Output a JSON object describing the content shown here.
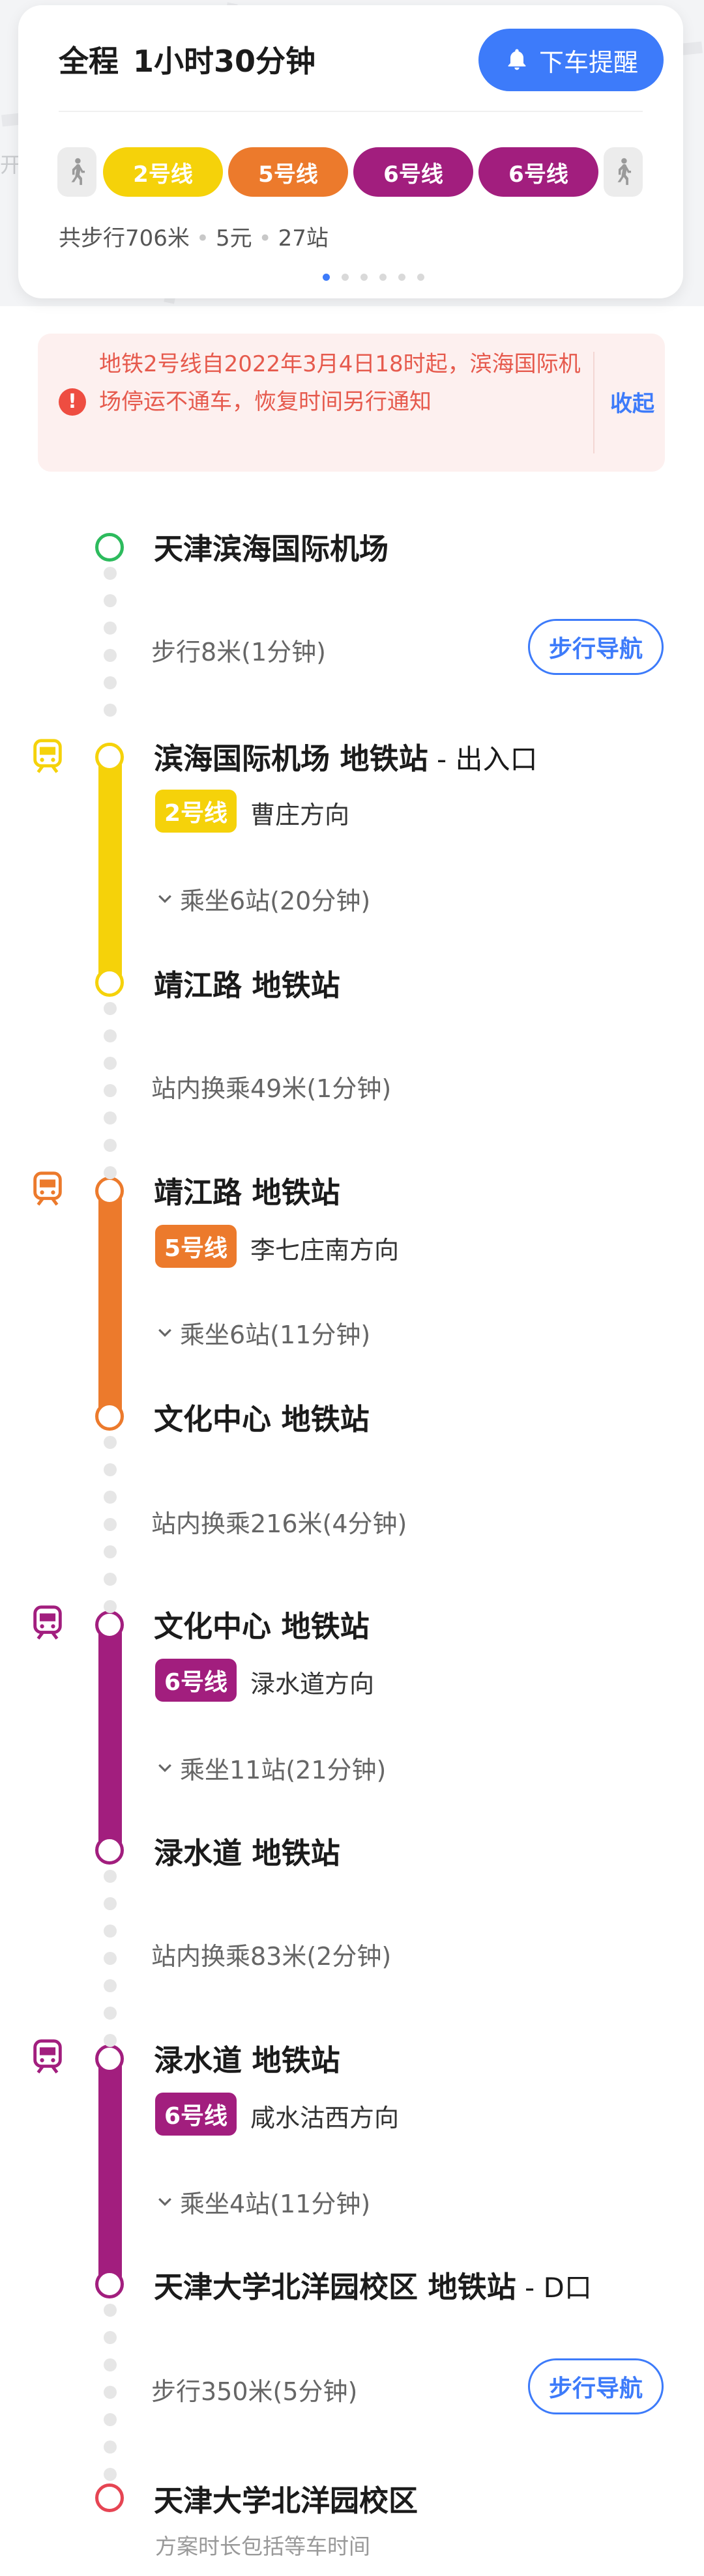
{
  "map": {
    "label": "开"
  },
  "summary": {
    "total_label": "全程",
    "duration": "1小时30分钟",
    "remind_button": "下车提醒",
    "lines": [
      {
        "label": "2号线",
        "color": "#f5d20a",
        "text_color": "#ffffff"
      },
      {
        "label": "5号线",
        "color": "#ec7a2c",
        "text_color": "#ffffff"
      },
      {
        "label": "6号线",
        "color": "#a21e7e",
        "text_color": "#ffffff"
      },
      {
        "label": "6号线",
        "color": "#a21e7e",
        "text_color": "#ffffff"
      }
    ],
    "walk_total": "共步行706米",
    "fare": "5元",
    "stops": "27站",
    "page_count": 6,
    "active_page": 1
  },
  "notice": {
    "text": "地铁2号线自2022年3月4日18时起，滨海国际机场停运不通车，恢复时间另行通知",
    "collapse": "收起",
    "icon": "alert-icon"
  },
  "route": {
    "start": "天津滨海国际机场",
    "walk1": "步行8米(1分钟)",
    "nav_label": "步行导航",
    "legs": [
      {
        "line": "2号线",
        "color": "#f5d20a",
        "board": "滨海国际机场 地铁站",
        "board_entrance": " - 出入口",
        "direction": "曹庄方向",
        "ride": "乘坐6站(20分钟)",
        "alight": "靖江路 地铁站",
        "transfer": "站内换乘49米(1分钟)"
      },
      {
        "line": "5号线",
        "color": "#ec7a2c",
        "board": "靖江路 地铁站",
        "direction": "李七庄南方向",
        "ride": "乘坐6站(11分钟)",
        "alight": "文化中心 地铁站",
        "transfer": "站内换乘216米(4分钟)"
      },
      {
        "line": "6号线",
        "color": "#a21e7e",
        "board": "文化中心 地铁站",
        "direction": "渌水道方向",
        "ride": "乘坐11站(21分钟)",
        "alight": "渌水道 地铁站",
        "transfer": "站内换乘83米(2分钟)"
      },
      {
        "line": "6号线",
        "color": "#a21e7e",
        "board": "渌水道 地铁站",
        "direction": "咸水沽西方向",
        "ride": "乘坐4站(11分钟)",
        "alight": "天津大学北洋园校区 地铁站",
        "alight_exit": " - D口"
      }
    ],
    "walk2": "步行350米(5分钟)",
    "end": "天津大学北洋园校区",
    "footnote": "方案时长包括等车时间",
    "start_color": "#2dbb5d",
    "end_color": "#e64553"
  }
}
